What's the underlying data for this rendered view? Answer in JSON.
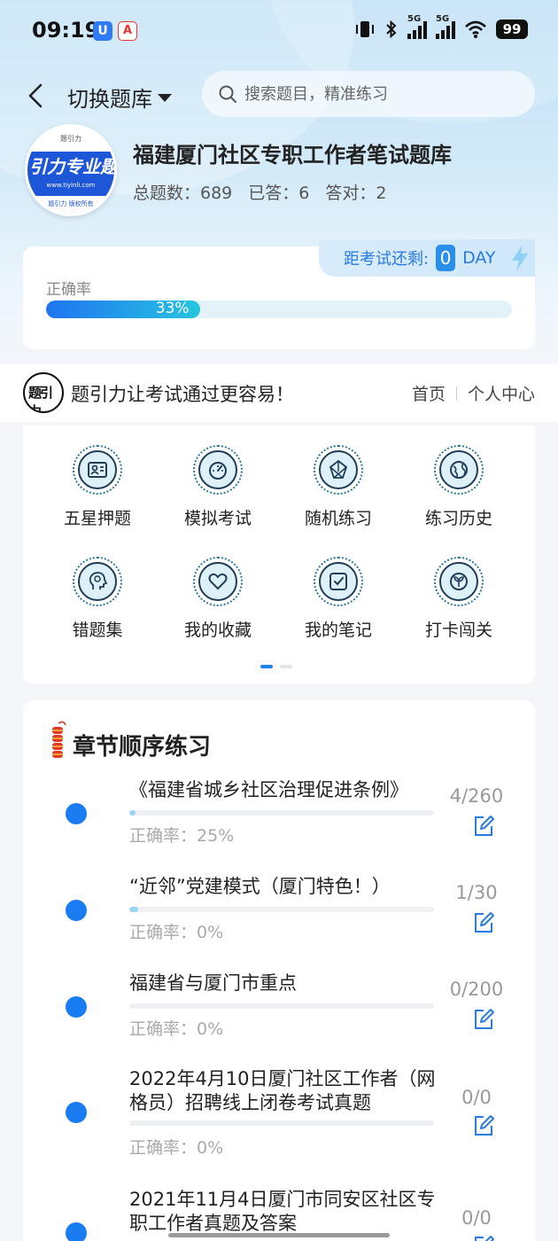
{
  "status_bar": {
    "time": "09:19",
    "app_icon_1": "U",
    "app_icon_2": "A",
    "network_1": "5G",
    "network_2": "5G",
    "battery": "99"
  },
  "header": {
    "switch_bank_label": "切换题库",
    "search_placeholder": "搜索题目，精准练习"
  },
  "bank": {
    "logo_text": "引力专业题",
    "logo_url": "www.tiyinli.com",
    "logo_sub": "题引力 版权所有",
    "title": "福建厦门社区专职工作者笔试题库",
    "stats": [
      {
        "label": "总题数",
        "value": "总题数：689"
      },
      {
        "label": "已答",
        "value": "已答：6"
      },
      {
        "label": "答对",
        "value": "答对：2"
      }
    ]
  },
  "accuracy": {
    "countdown_label": "距考试还剩:",
    "countdown_days": "0",
    "countdown_unit": "DAY",
    "label": "正确率",
    "percent_text": "33%",
    "fraction": 0.33
  },
  "brand": {
    "slogan": "题引力让考试通过更容易！",
    "nav_home": "首页",
    "nav_user": "个人中心"
  },
  "grid": {
    "items": [
      {
        "label": "五星押题",
        "icon": "id-card-icon"
      },
      {
        "label": "模拟考试",
        "icon": "gauge-icon"
      },
      {
        "label": "随机练习",
        "icon": "molecule-icon"
      },
      {
        "label": "练习历史",
        "icon": "globe-icon"
      },
      {
        "label": "错题集",
        "icon": "head-icon"
      },
      {
        "label": "我的收藏",
        "icon": "heart-icon"
      },
      {
        "label": "我的笔记",
        "icon": "note-icon"
      },
      {
        "label": "打卡闯关",
        "icon": "leaf-icon"
      }
    ],
    "page_count": 2,
    "active_page": 1
  },
  "chapters": {
    "title": "章节顺序练习",
    "items": [
      {
        "name": "《福建省城乡社区治理促进条例》",
        "accuracy": "正确率：25%",
        "count": "4/260",
        "progress": 0.015
      },
      {
        "name": "“近邻”党建模式（厦门特色！）",
        "accuracy": "正确率：0%",
        "count": "1/30",
        "progress": 0.03
      },
      {
        "name": "福建省与厦门市重点",
        "accuracy": "正确率：0%",
        "count": "0/200",
        "progress": 0
      },
      {
        "name": "2022年4月10日厦门社区工作者（网格员）招聘线上闭卷考试真题",
        "accuracy": "正确率：0%",
        "count": "0/0",
        "progress": 0
      },
      {
        "name": "2021年11月4日厦门市同安区社区专职工作者真题及答案",
        "accuracy": "",
        "count": "0/0",
        "progress": 0
      }
    ]
  },
  "colors": {
    "accent": "#1a7cf2",
    "progress_start": "#1f74f0",
    "progress_end": "#27c5e0",
    "icon_stroke": "#1f3d56"
  }
}
